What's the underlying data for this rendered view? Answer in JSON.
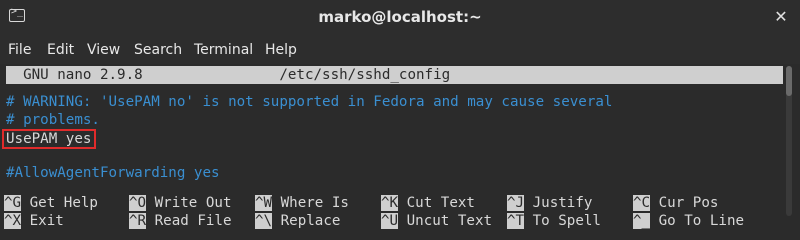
{
  "window": {
    "title": "marko@localhost:~",
    "terminal_icon_prompt": ">_"
  },
  "menubar": {
    "items": [
      "File",
      "Edit",
      "View",
      "Search",
      "Terminal",
      "Help"
    ]
  },
  "nano": {
    "header": "  GNU nano 2.9.8                /etc/ssh/sshd_config",
    "lines": [
      "# WARNING: 'UsePAM no' is not supported in Fedora and may cause several",
      "# problems.",
      "UsePAM yes",
      "",
      "#AllowAgentForwarding yes"
    ],
    "shortcuts_row1": [
      {
        "key": "^G",
        "label": "Get Help"
      },
      {
        "key": "^O",
        "label": "Write Out"
      },
      {
        "key": "^W",
        "label": "Where Is"
      },
      {
        "key": "^K",
        "label": "Cut Text"
      },
      {
        "key": "^J",
        "label": "Justify"
      },
      {
        "key": "^C",
        "label": "Cur Pos"
      }
    ],
    "shortcuts_row2": [
      {
        "key": "^X",
        "label": "Exit"
      },
      {
        "key": "^R",
        "label": "Read File"
      },
      {
        "key": "^\\",
        "label": "Replace"
      },
      {
        "key": "^U",
        "label": "Uncut Text"
      },
      {
        "key": "^T",
        "label": "To Spell"
      },
      {
        "key": "^_",
        "label": "Go To Line"
      }
    ]
  },
  "colors": {
    "background": "#2b2b2b",
    "comment": "#3a8fd1",
    "highlight_box": "#e02b2b",
    "header_bar": "#cfcfcf"
  },
  "icons": {
    "terminal": "terminal-icon",
    "close": "close-icon"
  }
}
